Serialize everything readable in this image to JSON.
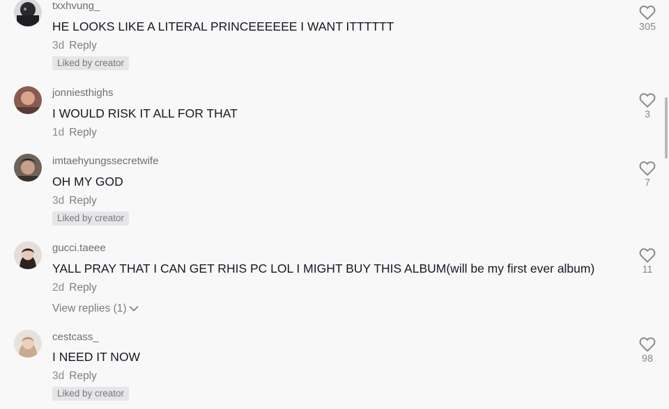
{
  "comments": [
    {
      "username": "txxhvung_",
      "text": "HE LOOKS LIKE A LITERAL PRINCEEEEEE I WANT ITTTTTT",
      "time": "3d",
      "reply_label": "Reply",
      "badge": "Liked by creator",
      "likes": "305",
      "avatar_color": "#2a2a2e"
    },
    {
      "username": "jonniesthighs",
      "text": "I WOULD RISK IT ALL FOR THAT",
      "time": "1d",
      "reply_label": "Reply",
      "likes": "3",
      "avatar_color": "#5a3a36"
    },
    {
      "username": "imtaehyungssecretwife",
      "text": "OH MY GOD",
      "time": "3d",
      "reply_label": "Reply",
      "badge": "Liked by creator",
      "likes": "7",
      "avatar_color": "#4a3f38"
    },
    {
      "username": "gucci.taeee",
      "text": "YALL PRAY THAT I CAN GET RHIS PC LOL I MIGHT BUY THIS ALBUM(will be my first ever album)",
      "time": "2d",
      "reply_label": "Reply",
      "view_replies": "View replies (1)",
      "likes": "11",
      "avatar_color": "#d9d2cc"
    },
    {
      "username": "cestcass_",
      "text": "I NEED IT NOW",
      "time": "3d",
      "reply_label": "Reply",
      "badge": "Liked by creator",
      "likes": "98",
      "avatar_color": "#c8ab8c"
    }
  ],
  "icons": {
    "like": "heart-outline-icon",
    "expand": "chevron-down-icon"
  },
  "colors": {
    "text": "#161823",
    "secondary": "#8a8b91",
    "badge_bg": "#e6e6e8",
    "background": "#f8f8f8"
  }
}
